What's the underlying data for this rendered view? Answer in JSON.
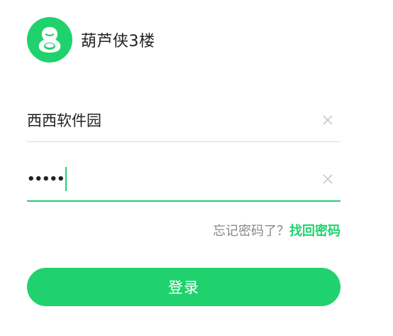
{
  "header": {
    "app_name": "葫芦侠3楼",
    "logo_icon": "gourd-logo-icon"
  },
  "form": {
    "username": {
      "value": "西西软件园",
      "clear_icon": "close-icon"
    },
    "password": {
      "masked_value": "•••••",
      "clear_icon": "close-icon"
    },
    "forgot": {
      "prompt": "忘记密码了？",
      "link_label": "找回密码"
    },
    "login_label": "登录"
  },
  "colors": {
    "accent": "#1fd26d",
    "divider": "#dcdcdc",
    "muted_text": "#888888"
  }
}
